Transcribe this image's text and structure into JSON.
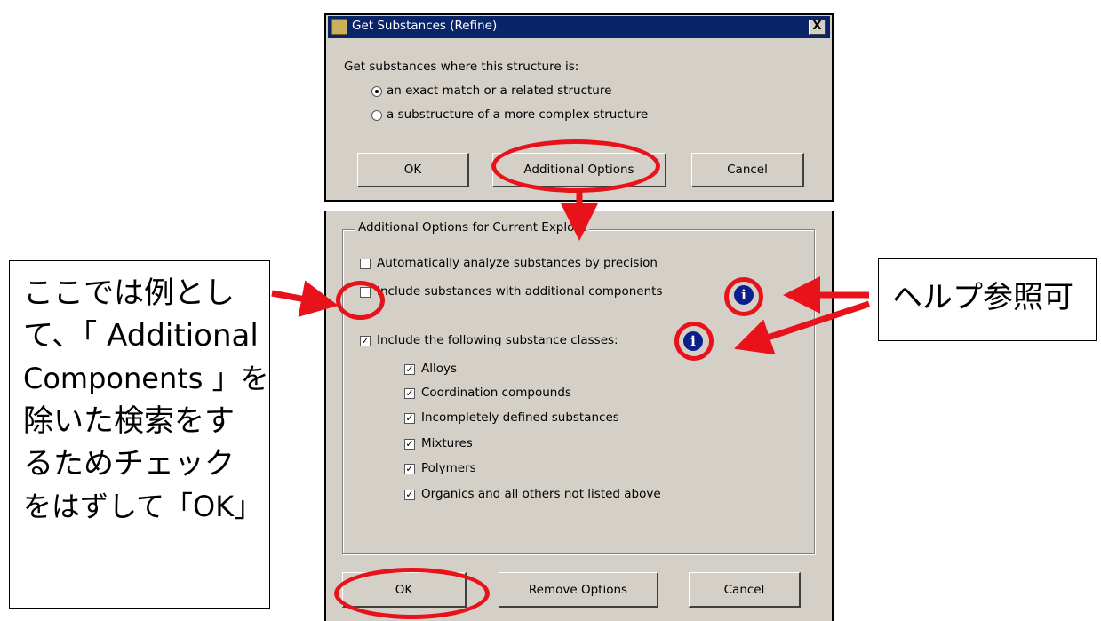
{
  "dialog_top": {
    "title": "Get Substances (Refine)",
    "close_label": "X",
    "prompt": "Get substances where this structure is:",
    "options": [
      {
        "label": "an exact match or a related structure",
        "selected": true
      },
      {
        "label": "a substructure of a more complex structure",
        "selected": false
      }
    ],
    "buttons": {
      "ok": "OK",
      "additional": "Additional Options",
      "cancel": "Cancel"
    }
  },
  "dialog_bottom": {
    "group_title": "Additional Options for Current Explore",
    "auto_analyze": {
      "label": "Automatically analyze substances by precision",
      "checked": false
    },
    "include_additional": {
      "label": "Include substances with additional components",
      "checked": false
    },
    "include_classes": {
      "label": "Include the following substance classes:",
      "checked": true
    },
    "classes": [
      {
        "label": "Alloys",
        "checked": true
      },
      {
        "label": "Coordination compounds",
        "checked": true
      },
      {
        "label": "Incompletely defined substances",
        "checked": true
      },
      {
        "label": "Mixtures",
        "checked": true
      },
      {
        "label": "Polymers",
        "checked": true
      },
      {
        "label": "Organics and all others not listed above",
        "checked": true
      }
    ],
    "buttons": {
      "ok": "OK",
      "remove": "Remove Options",
      "cancel": "Cancel"
    }
  },
  "annotations": {
    "left_note_lines": [
      "ここでは例とし",
      "て、「 Additional",
      "Components 」を",
      "除いた検索をす",
      "るためチェック",
      "をはずして「OK」"
    ],
    "right_note": "ヘルプ参照可",
    "accent_color": "#e8121b",
    "icons": [
      "info-icon",
      "red-arrow"
    ]
  }
}
